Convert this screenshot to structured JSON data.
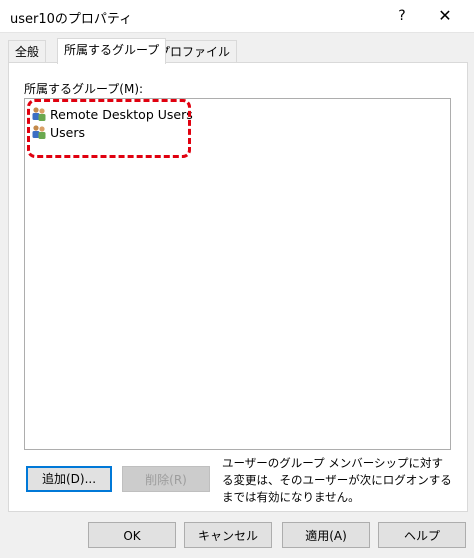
{
  "window": {
    "title": "user10のプロパティ",
    "help_label": "?",
    "close_label": "✕"
  },
  "tabs": [
    {
      "label": "全般",
      "active": false
    },
    {
      "label": "所属するグループ",
      "active": true
    },
    {
      "label": "プロファイル",
      "active": false
    }
  ],
  "groups": {
    "label": "所属するグループ(M):",
    "items": [
      {
        "name": "Remote Desktop Users",
        "icon": "group-icon"
      },
      {
        "name": "Users",
        "icon": "group-icon"
      }
    ]
  },
  "actions": {
    "add_label": "追加(D)...",
    "remove_label": "削除(R)",
    "note": "ユーザーのグループ メンバーシップに対する変更は、そのユーザーが次にログオンするまでは有効になりません。"
  },
  "footer": {
    "ok_label": "OK",
    "cancel_label": "キャンセル",
    "apply_label": "適用(A)",
    "help_label": "ヘルプ"
  },
  "colors": {
    "accent": "#0078d7",
    "highlight": "#e0000f"
  }
}
